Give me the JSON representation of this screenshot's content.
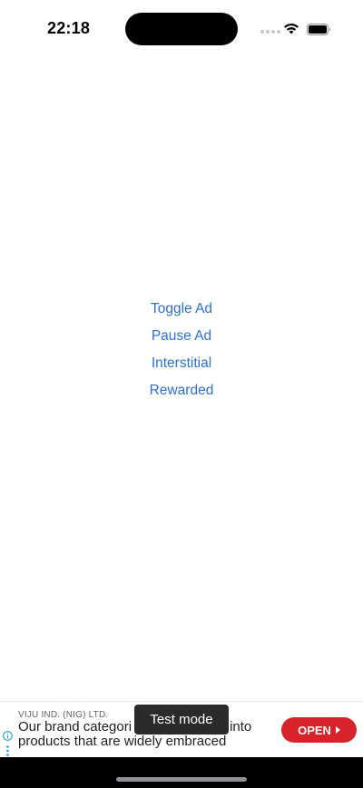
{
  "status_bar": {
    "time": "22:18",
    "icons": [
      "cellular-dots-icon",
      "wifi-icon",
      "battery-icon"
    ]
  },
  "menu": {
    "items": [
      {
        "label": "Toggle Ad"
      },
      {
        "label": "Pause Ad"
      },
      {
        "label": "Interstitial"
      },
      {
        "label": "Rewarded"
      }
    ]
  },
  "ad": {
    "advertiser": "VIJU IND. (NIG) LTD.",
    "text_line1": "Our brand categori",
    "text_line1_end": "into",
    "text_line2": "products that are widely embraced",
    "cta_label": "OPEN",
    "badge": "Test mode",
    "icons": [
      "ad-info-icon",
      "ad-options-icon",
      "open-arrow-icon"
    ]
  },
  "colors": {
    "accent": "#2c6fd6",
    "ad_cta": "#d9232a",
    "badge_bg": "#2b2b2b"
  }
}
